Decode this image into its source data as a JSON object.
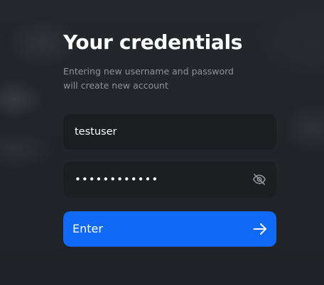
{
  "form": {
    "title": "Your credentials",
    "subtitle": "Entering new username and password will create new account",
    "username": {
      "value": "testuser",
      "placeholder": ""
    },
    "password": {
      "value": "••••••••••••",
      "masked": true,
      "visibility_icon": "eye-off-icon"
    },
    "submit": {
      "label": "Enter",
      "icon": "arrow-right-icon"
    }
  },
  "colors": {
    "background": "#22252a",
    "field_background": "#1c1e22",
    "accent": "#1169f7",
    "subtitle_text": "#8d939c"
  }
}
